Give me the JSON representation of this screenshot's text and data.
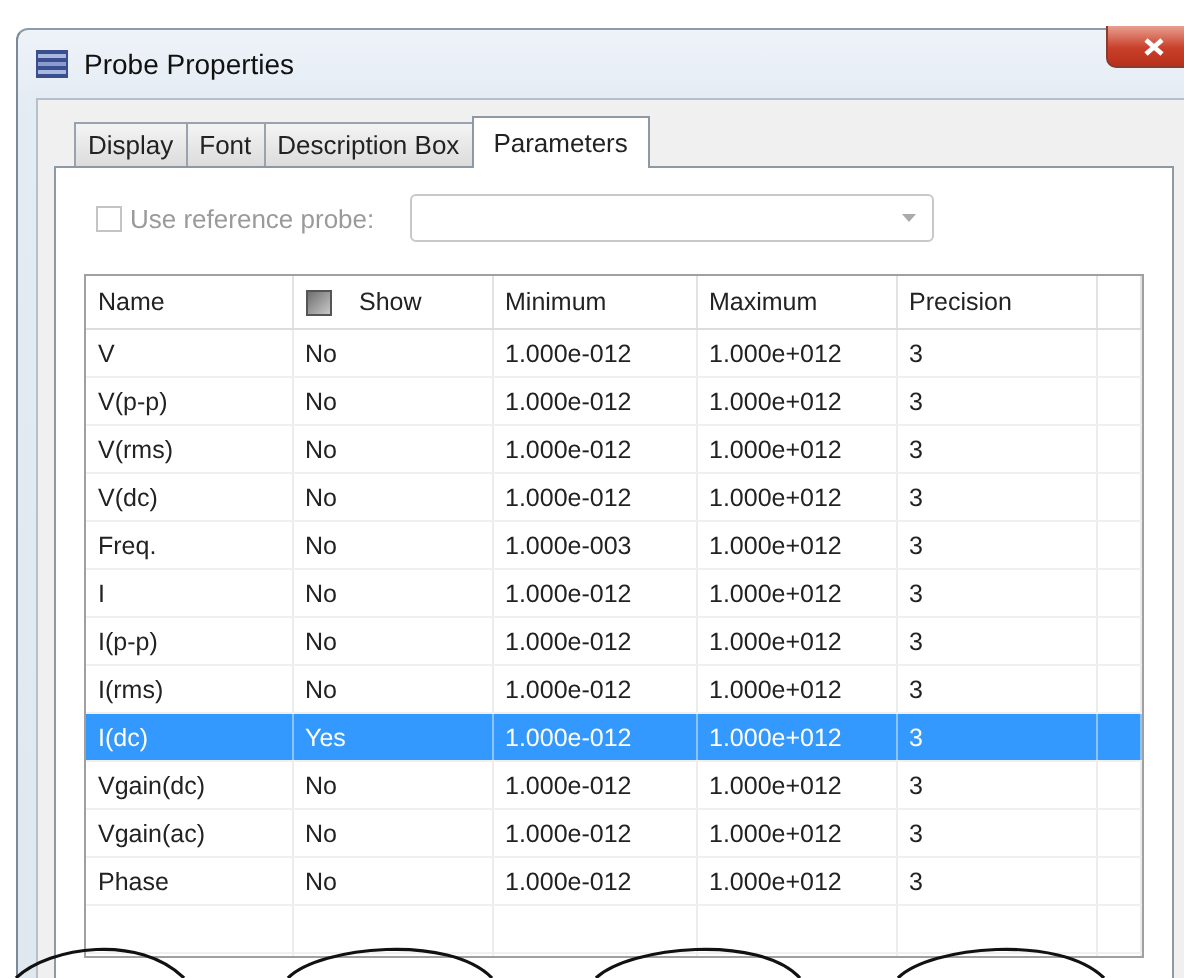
{
  "window": {
    "title": "Probe Properties"
  },
  "tabs": [
    {
      "label": "Display",
      "selected": false
    },
    {
      "label": "Font",
      "selected": false
    },
    {
      "label": "Description Box",
      "selected": false
    },
    {
      "label": "Parameters",
      "selected": true
    }
  ],
  "reference_probe": {
    "label": "Use reference probe:",
    "checked": false,
    "disabled": true
  },
  "table": {
    "columns": [
      {
        "kind": "text",
        "label": "Name"
      },
      {
        "kind": "checkbox",
        "label": "Show",
        "mixed": true
      },
      {
        "kind": "text",
        "label": "Minimum"
      },
      {
        "kind": "text",
        "label": "Maximum"
      },
      {
        "kind": "text",
        "label": "Precision"
      }
    ],
    "rows": [
      {
        "cells": [
          "V",
          "No",
          "1.000e-012",
          "1.000e+012",
          "3"
        ],
        "selected": false
      },
      {
        "cells": [
          "V(p-p)",
          "No",
          "1.000e-012",
          "1.000e+012",
          "3"
        ],
        "selected": false
      },
      {
        "cells": [
          "V(rms)",
          "No",
          "1.000e-012",
          "1.000e+012",
          "3"
        ],
        "selected": false
      },
      {
        "cells": [
          "V(dc)",
          "No",
          "1.000e-012",
          "1.000e+012",
          "3"
        ],
        "selected": false
      },
      {
        "cells": [
          "Freq.",
          "No",
          "1.000e-003",
          "1.000e+012",
          "3"
        ],
        "selected": false
      },
      {
        "cells": [
          "I",
          "No",
          "1.000e-012",
          "1.000e+012",
          "3"
        ],
        "selected": false
      },
      {
        "cells": [
          "I(p-p)",
          "No",
          "1.000e-012",
          "1.000e+012",
          "3"
        ],
        "selected": false
      },
      {
        "cells": [
          "I(rms)",
          "No",
          "1.000e-012",
          "1.000e+012",
          "3"
        ],
        "selected": false
      },
      {
        "cells": [
          "I(dc)",
          "Yes",
          "1.000e-012",
          "1.000e+012",
          "3"
        ],
        "selected": true
      },
      {
        "cells": [
          "Vgain(dc)",
          "No",
          "1.000e-012",
          "1.000e+012",
          "3"
        ],
        "selected": false
      },
      {
        "cells": [
          "Vgain(ac)",
          "No",
          "1.000e-012",
          "1.000e+012",
          "3"
        ],
        "selected": false
      },
      {
        "cells": [
          "Phase",
          "No",
          "1.000e-012",
          "1.000e+012",
          "3"
        ],
        "selected": false
      }
    ]
  }
}
